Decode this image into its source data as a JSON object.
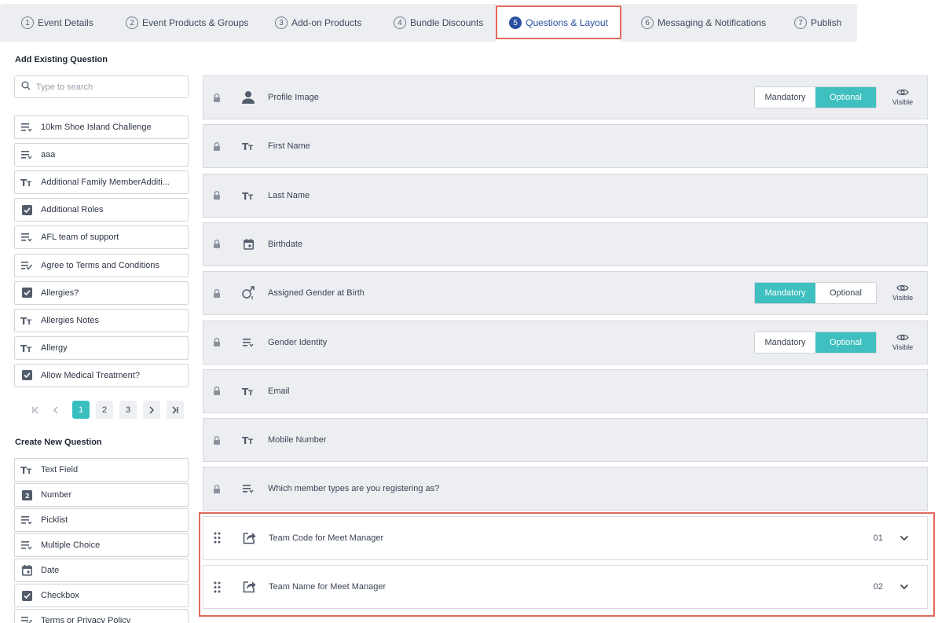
{
  "tabs": [
    {
      "num": "1",
      "label": "Event Details"
    },
    {
      "num": "2",
      "label": "Event Products & Groups"
    },
    {
      "num": "3",
      "label": "Add-on Products"
    },
    {
      "num": "4",
      "label": "Bundle Discounts"
    },
    {
      "num": "5",
      "label": "Questions & Layout"
    },
    {
      "num": "6",
      "label": "Messaging & Notifications"
    },
    {
      "num": "7",
      "label": "Publish"
    }
  ],
  "active_tab": "5",
  "left": {
    "existing_heading": "Add Existing Question",
    "search_placeholder": "Type to search",
    "existing": [
      {
        "label": "10km Shoe Island Challenge",
        "icon": "picklist-icon"
      },
      {
        "label": "aaa",
        "icon": "picklist-icon"
      },
      {
        "label": "Additional Family MemberAdditi...",
        "icon": "text-field-icon"
      },
      {
        "label": "Additional Roles",
        "icon": "checkbox-icon"
      },
      {
        "label": "AFL team of support",
        "icon": "picklist-icon"
      },
      {
        "label": "Agree to Terms and Conditions",
        "icon": "terms-icon"
      },
      {
        "label": "Allergies?",
        "icon": "checkbox-icon"
      },
      {
        "label": "Allergies Notes",
        "icon": "text-field-icon"
      },
      {
        "label": "Allergy",
        "icon": "text-field-icon"
      },
      {
        "label": "Allow Medical Treatment?",
        "icon": "checkbox-icon"
      }
    ],
    "pages": [
      "1",
      "2",
      "3"
    ],
    "current_page": "1",
    "create_heading": "Create New Question",
    "create": [
      {
        "label": "Text Field",
        "icon": "text-field-icon"
      },
      {
        "label": "Number",
        "icon": "number-icon"
      },
      {
        "label": "Picklist",
        "icon": "picklist-icon"
      },
      {
        "label": "Multiple Choice",
        "icon": "picklist-icon"
      },
      {
        "label": "Date",
        "icon": "calendar-icon"
      },
      {
        "label": "Checkbox",
        "icon": "checkbox-icon"
      },
      {
        "label": "Terms or Privacy Policy",
        "icon": "terms-icon"
      }
    ]
  },
  "toggle_labels": {
    "mandatory": "Mandatory",
    "optional": "Optional",
    "visible": "Visible"
  },
  "questions": [
    {
      "label": "Profile Image",
      "icon": "person-icon",
      "locked": true,
      "requirement": "Optional",
      "visible": true
    },
    {
      "label": "First Name",
      "icon": "text-field-icon",
      "locked": true
    },
    {
      "label": "Last Name",
      "icon": "text-field-icon",
      "locked": true
    },
    {
      "label": "Birthdate",
      "icon": "calendar-icon",
      "locked": true
    },
    {
      "label": "Assigned Gender at Birth",
      "icon": "gender-icon",
      "locked": true,
      "requirement": "Mandatory",
      "visible": true
    },
    {
      "label": "Gender Identity",
      "icon": "picklist-icon",
      "locked": true,
      "requirement": "Optional",
      "visible": true
    },
    {
      "label": "Email",
      "icon": "text-field-icon",
      "locked": true
    },
    {
      "label": "Mobile Number",
      "icon": "text-field-icon",
      "locked": true
    },
    {
      "label": "Which member types are you registering as?",
      "icon": "picklist-icon",
      "locked": true
    },
    {
      "label": "Team Code for Meet Manager",
      "icon": "share-icon",
      "locked": false,
      "order": "01"
    },
    {
      "label": "Team Name for Meet Manager",
      "icon": "share-icon",
      "locked": false,
      "order": "02"
    }
  ],
  "colors": {
    "accent_teal": "#3fbfbf",
    "active_tab": "#2a4ea0",
    "highlight": "#e06a5c"
  }
}
